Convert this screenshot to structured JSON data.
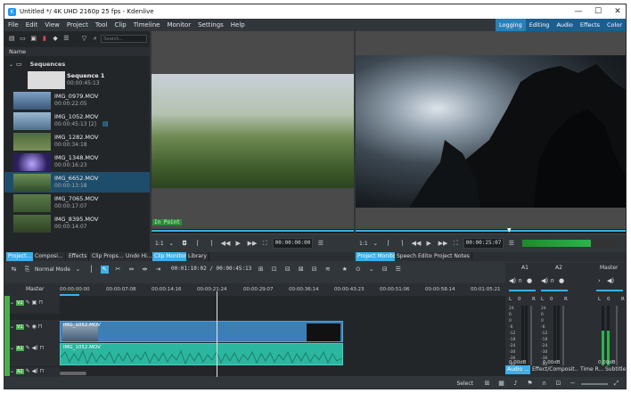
{
  "window": {
    "title": "Untitled */ 4K UHD 2160p 25 fps - Kdenlive",
    "min": "—",
    "max": "☐",
    "close": "✕"
  },
  "menu": [
    "File",
    "Edit",
    "View",
    "Project",
    "Tool",
    "Clip",
    "Timeline",
    "Monitor",
    "Settings",
    "Help"
  ],
  "layouts": [
    "Logging",
    "Editing",
    "Audio",
    "Effects",
    "Color"
  ],
  "bin": {
    "search_placeholder": "Search...",
    "header_name": "Name",
    "folder": "Sequences",
    "items": [
      {
        "name": "Sequence 1",
        "duration": "00:00:45:13"
      },
      {
        "name": "IMG_0979.MOV",
        "duration": "00:00:22:05"
      },
      {
        "name": "IMG_1052.MOV",
        "duration": "00:00:45:13 [2]"
      },
      {
        "name": "IMG_1282.MOV",
        "duration": "00:00:34:18"
      },
      {
        "name": "IMG_1348.MOV",
        "duration": "00:00:16:23"
      },
      {
        "name": "IMG_6652.MOV",
        "duration": "00:00:13:18"
      },
      {
        "name": "IMG_7065.MOV",
        "duration": "00:00:17:07"
      },
      {
        "name": "IMG_8395.MOV",
        "duration": "00:00:14:07"
      }
    ]
  },
  "left_tabs": [
    "Project...",
    "Composi...",
    "Effects",
    "Clip Props...",
    "Undo Hi...",
    "Clip Monitor",
    "Library"
  ],
  "clip_monitor": {
    "in_point": "In Point",
    "zoom": "1:1",
    "timecode": "00:00:00:00"
  },
  "project_monitor": {
    "zoom": "1:1",
    "timecode": "00:00:25:07"
  },
  "right_tabs": [
    "Project Monitor",
    "Speech Editor",
    "Project Notes"
  ],
  "timeline": {
    "mode": "Normal Mode",
    "position": "00:01:10:02 / 00:00:45:13",
    "master": "Master",
    "ruler": [
      "00:00:00:00",
      "00:00:07:08",
      "00:00:14:16",
      "00:00:21:24",
      "00:00:29:07",
      "00:00:36:14",
      "00:00:43:23",
      "00:00:51:06",
      "00:00:58:14",
      "00:01:05:21"
    ],
    "tracks": [
      {
        "label": "V2"
      },
      {
        "label": "V1",
        "clip": "IMG_1052.MOV"
      },
      {
        "label": "A1",
        "clip": "IMG_1052.MOV"
      },
      {
        "label": "A2"
      }
    ]
  },
  "mixer": {
    "channels": [
      {
        "name": "A1",
        "db": "0.00dB"
      },
      {
        "name": "A2",
        "db": "0.00dB"
      },
      {
        "name": "Master",
        "db": "0.00dB"
      }
    ],
    "lr": [
      "L",
      "0",
      "R",
      "L",
      "0",
      "R",
      "L",
      "0",
      "R"
    ],
    "scale": [
      "24",
      "6",
      "0",
      "-6",
      "-12",
      "-18",
      "-24",
      "-30",
      "-36",
      "-42"
    ]
  },
  "bottom_tabs": [
    "Audio ...",
    "Effect/Composit...",
    "Time R...",
    "Subtitles"
  ],
  "status": {
    "select": "Select"
  },
  "colors": {
    "accent": "#3daee9",
    "video_clip": "#3b7fb5",
    "audio_clip": "#2bb6a0",
    "track_green": "#4caf50"
  }
}
